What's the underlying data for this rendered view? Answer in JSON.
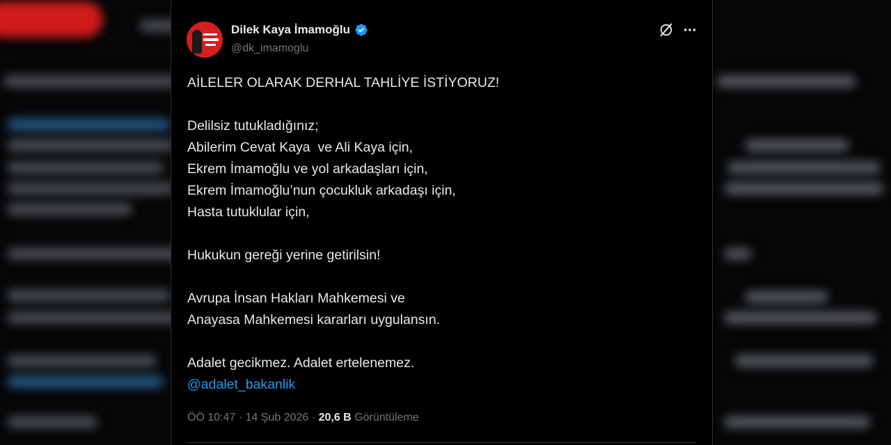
{
  "tweet": {
    "author_name": "Dilek Kaya İmamoğlu",
    "handle": "@dk_imamoglu",
    "lines": [
      "AİLELER OLARAK DERHAL TAHLİYE İSTİYORUZ!",
      "",
      "Delilsiz tutukladığınız;",
      "Abilerim Cevat Kaya  ve Ali Kaya için,",
      "Ekrem İmamoğlu ve yol arkadaşları için,",
      "Ekrem İmamoğlu’nun çocukluk arkadaşı için,",
      "Hasta tutuklular için,",
      "",
      "Hukukun gereği yerine getirilsin!",
      "",
      "Avrupa İnsan Hakları Mahkemesi ve",
      "Anayasa Mahkemesi kararları uygulansın.",
      "",
      "Adalet gecikmez. Adalet ertelenemez."
    ],
    "mention": "@adalet_bakanlik",
    "time": "ÖÖ 10:47",
    "date": "14 Şub 2026",
    "views_count": "20,6 B",
    "views_label": "Görüntüleme"
  },
  "icons": {
    "verified": "verified-badge-icon",
    "grok": "grok-icon",
    "more": "more-dots-icon"
  },
  "colors": {
    "accent": "#1d9bf0",
    "avatar_bg": "#d51e1e",
    "background": "#000000",
    "muted_text": "#71767b"
  }
}
